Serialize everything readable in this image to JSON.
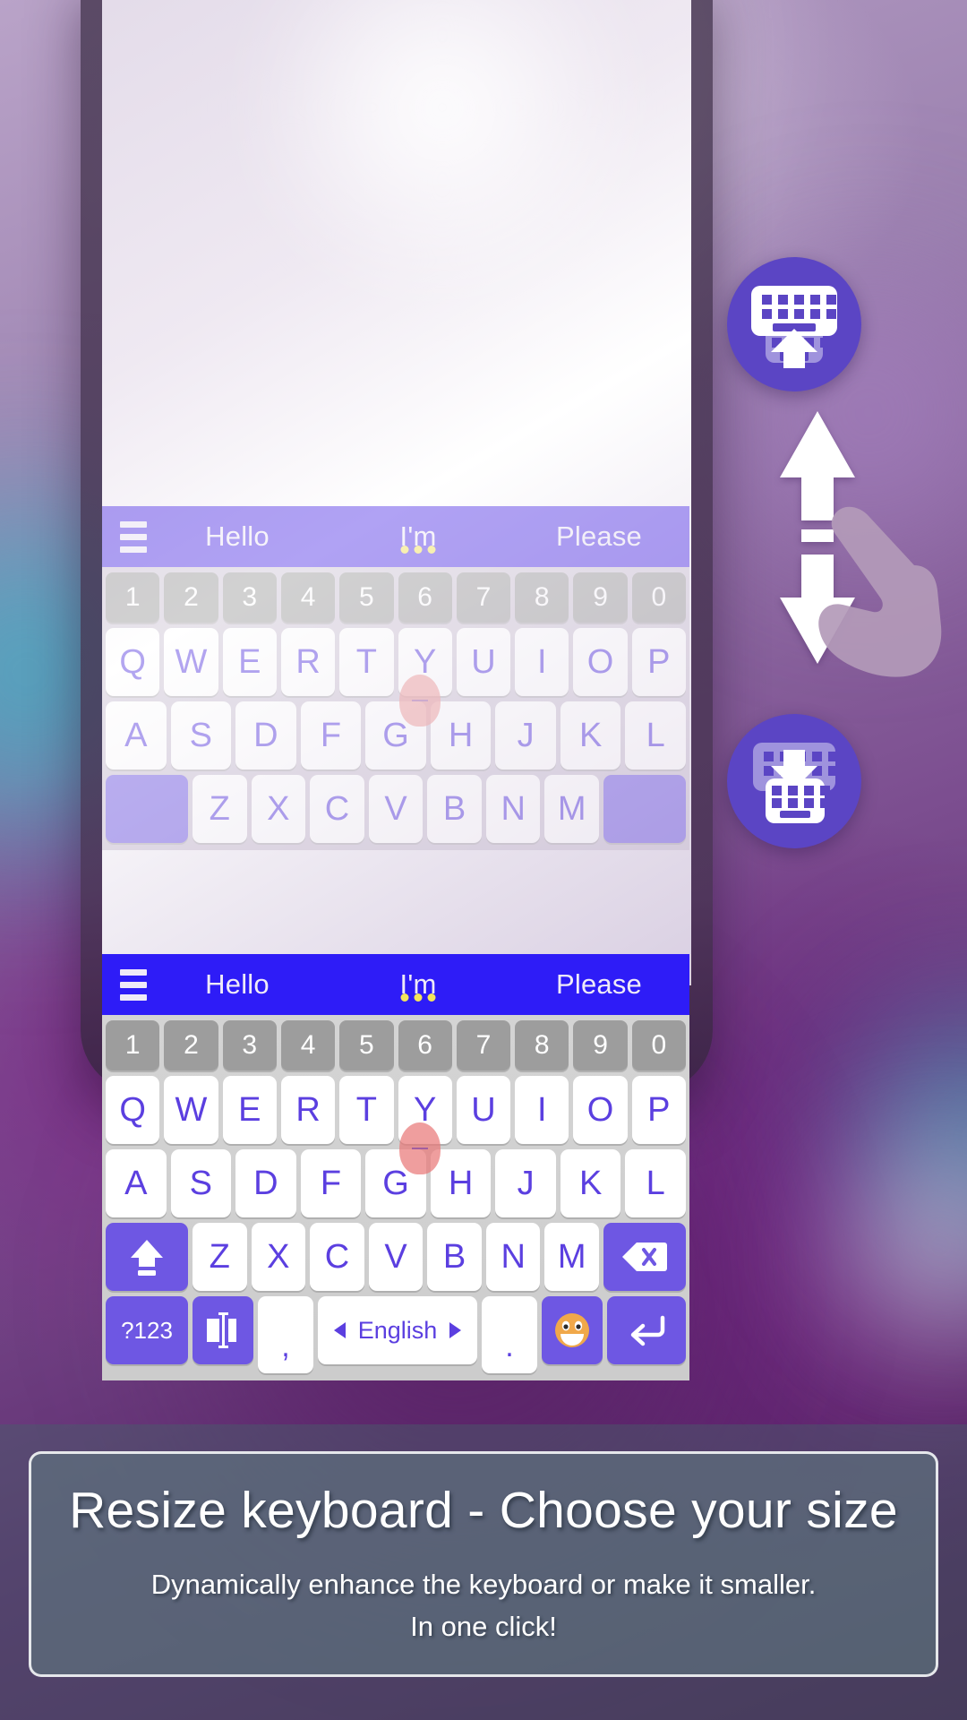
{
  "app": {
    "type": "android-keyboard-promo",
    "accent_purple": "#6e57e3",
    "suggestion_bar_blue": "#2e1cf7",
    "fab_purple": "#5b45c4",
    "key_text_color": "#5b3fe0",
    "number_key_bg": "#9d9d9d"
  },
  "suggestion_bar": {
    "menu_icon": "hamburger-menu-icon",
    "words": [
      {
        "label": "Hello",
        "has_more_dots": false
      },
      {
        "label": "I'm",
        "has_more_dots": true
      },
      {
        "label": "Please",
        "has_more_dots": false
      }
    ]
  },
  "keyboard": {
    "number_row": [
      "1",
      "2",
      "3",
      "4",
      "5",
      "6",
      "7",
      "8",
      "9",
      "0"
    ],
    "row1": [
      "Q",
      "W",
      "E",
      "R",
      "T",
      "Y",
      "U",
      "I",
      "O",
      "P"
    ],
    "row2": [
      "A",
      "S",
      "D",
      "F",
      "G",
      "H",
      "J",
      "K",
      "L"
    ],
    "row3": {
      "shift_icon": "shift-arrow-up-icon",
      "letters": [
        "Z",
        "X",
        "C",
        "V",
        "B",
        "N",
        "M"
      ],
      "backspace_icon": "backspace-icon"
    },
    "row4": {
      "symbols_label": "?123",
      "cursor_icon": "cursor-control-icon",
      "comma_label": ",",
      "space_label": "English",
      "space_prev_icon": "arrow-left-icon",
      "space_next_icon": "arrow-right-icon",
      "period_label": ".",
      "emoji_icon": "smiley-emoji-icon",
      "enter_icon": "enter-return-icon"
    }
  },
  "floating_buttons": [
    {
      "name": "enlarge-keyboard-button",
      "icon": "keyboard-up-arrow-icon",
      "direction": "up"
    },
    {
      "name": "shrink-keyboard-button",
      "icon": "keyboard-down-arrow-icon",
      "direction": "down"
    }
  ],
  "gesture": {
    "icon": "resize-double-arrow-icon",
    "hand_icon": "pointing-hand-icon"
  },
  "caption": {
    "title": "Resize keyboard - Choose your size",
    "line1": "Dynamically enhance the keyboard or make it smaller.",
    "line2": "In one click!"
  }
}
